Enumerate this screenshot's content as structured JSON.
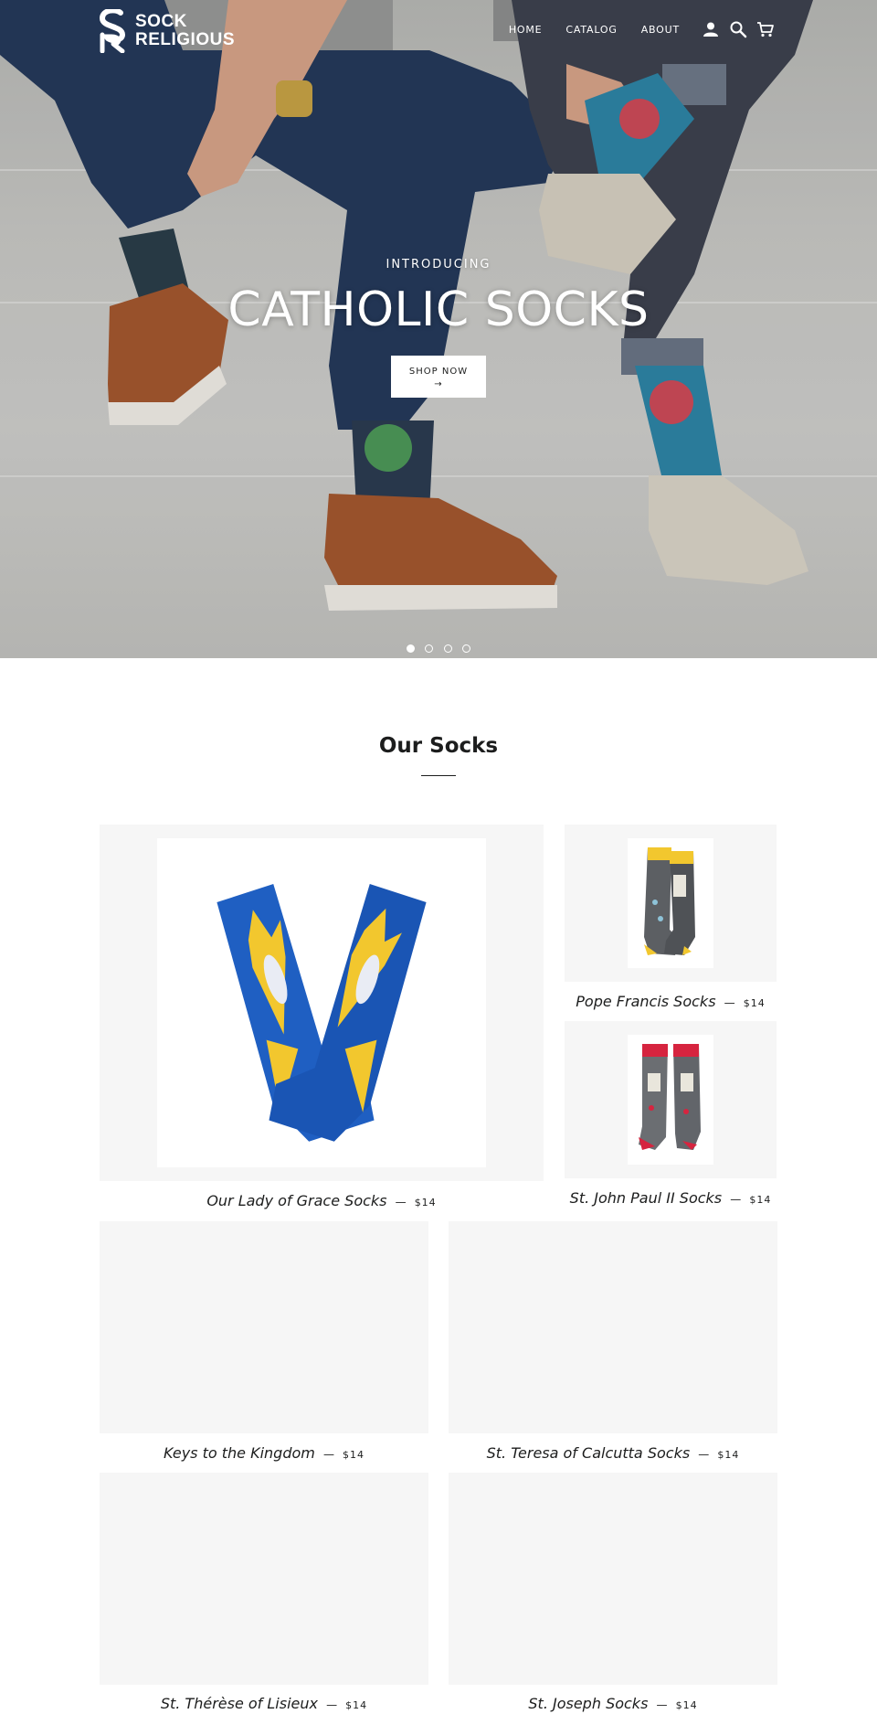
{
  "header": {
    "logo": {
      "line1": "SOCK",
      "line2": "RELIGIOUS"
    },
    "nav": [
      "HOME",
      "CATALOG",
      "ABOUT"
    ],
    "icons": [
      "account-icon",
      "search-icon",
      "cart-icon"
    ]
  },
  "hero": {
    "subtitle": "INTRODUCING",
    "title": "CATHOLIC SOCKS",
    "button": "SHOP NOW",
    "button_arrow": "→",
    "slides": 4,
    "active_slide": 1
  },
  "collection": {
    "title": "Our Socks",
    "products": [
      {
        "title": "Our Lady of Grace Socks",
        "separator": "—",
        "price": "$14"
      },
      {
        "title": "Pope Francis Socks",
        "separator": "—",
        "price": "$14"
      },
      {
        "title": "St. John Paul II Socks",
        "separator": "—",
        "price": "$14"
      },
      {
        "title": "Keys to the Kingdom",
        "separator": "—",
        "price": "$14"
      },
      {
        "title": "St. Teresa of Calcutta Socks",
        "separator": "—",
        "price": "$14"
      },
      {
        "title": "St. Thérèse of Lisieux",
        "separator": "—",
        "price": "$14"
      },
      {
        "title": "St. Joseph Socks",
        "separator": "—",
        "price": "$14"
      }
    ]
  },
  "colors": {
    "text": "#1c1d1d",
    "placeholder_bg": "#f6f6f6",
    "sock_blue": "#1f5fc2",
    "sock_yellow": "#f2c72e",
    "sock_gray": "#5c5f63",
    "sock_red": "#d6243f"
  }
}
